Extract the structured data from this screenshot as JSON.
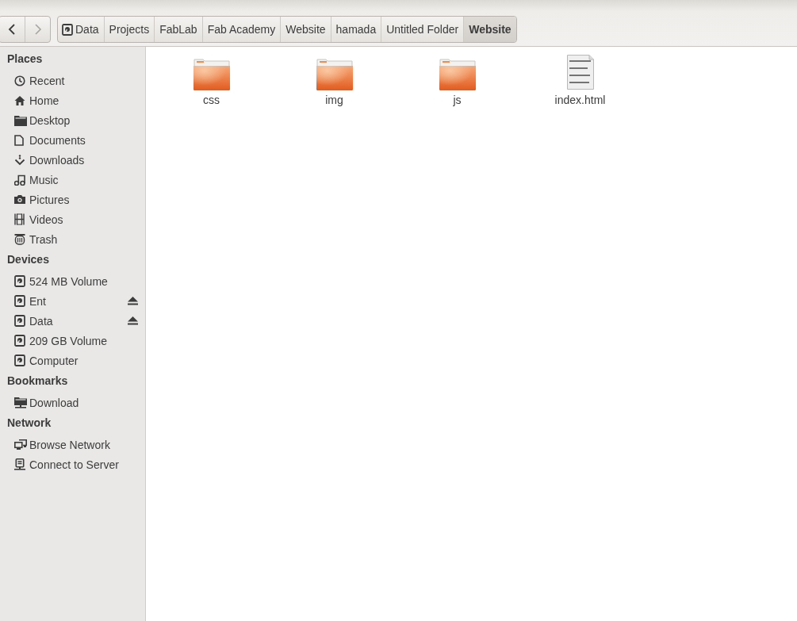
{
  "navigation": {
    "back": {
      "disabled": false
    },
    "forward": {
      "disabled": true
    }
  },
  "path_bar": [
    {
      "label": "Data",
      "selected": false
    },
    {
      "label": "Projects",
      "selected": false
    },
    {
      "label": "FabLab",
      "selected": false
    },
    {
      "label": "Fab Academy",
      "selected": false
    },
    {
      "label": "Website",
      "selected": false
    },
    {
      "label": "hamada",
      "selected": false
    },
    {
      "label": "Untitled Folder",
      "selected": false
    },
    {
      "label": "Website",
      "selected": true
    }
  ],
  "sidebar": {
    "sections": [
      {
        "heading": "Places",
        "items": [
          {
            "label": "Recent",
            "kind": "recent"
          },
          {
            "label": "Home",
            "kind": "home"
          },
          {
            "label": "Desktop",
            "kind": "desktop"
          },
          {
            "label": "Documents",
            "kind": "document"
          },
          {
            "label": "Downloads",
            "kind": "downloads"
          },
          {
            "label": "Music",
            "kind": "music"
          },
          {
            "label": "Pictures",
            "kind": "camera"
          },
          {
            "label": "Videos",
            "kind": "film"
          },
          {
            "label": "Trash",
            "kind": "trash"
          }
        ]
      },
      {
        "heading": "Devices",
        "items": [
          {
            "label": "524 MB Volume",
            "kind": "drive",
            "ejectable": false
          },
          {
            "label": "Ent",
            "kind": "drive",
            "ejectable": true
          },
          {
            "label": "Data",
            "kind": "drive",
            "ejectable": true
          },
          {
            "label": "209 GB Volume",
            "kind": "drive",
            "ejectable": false
          },
          {
            "label": "Computer",
            "kind": "drive",
            "ejectable": false
          }
        ]
      },
      {
        "heading": "Bookmarks",
        "items": [
          {
            "label": "Download",
            "kind": "remote-folder"
          }
        ]
      },
      {
        "heading": "Network",
        "items": [
          {
            "label": "Browse Network",
            "kind": "network"
          },
          {
            "label": "Connect to Server",
            "kind": "server"
          }
        ]
      }
    ]
  },
  "files": [
    {
      "name": "css",
      "kind": "folder"
    },
    {
      "name": "img",
      "kind": "folder"
    },
    {
      "name": "js",
      "kind": "folder"
    },
    {
      "name": "index.html",
      "kind": "html"
    }
  ]
}
